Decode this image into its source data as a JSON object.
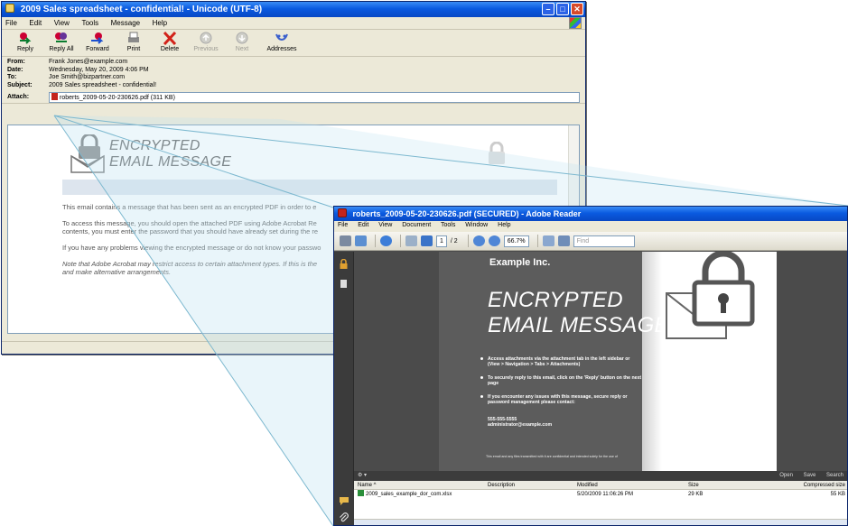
{
  "email": {
    "title": "2009 Sales spreadsheet - confidential! - Unicode (UTF-8)",
    "menu": [
      "File",
      "Edit",
      "View",
      "Tools",
      "Message",
      "Help"
    ],
    "toolbar": {
      "reply": "Reply",
      "reply_all": "Reply All",
      "forward": "Forward",
      "print": "Print",
      "delete": "Delete",
      "previous": "Previous",
      "next": "Next",
      "addresses": "Addresses"
    },
    "headers": {
      "from_label": "From:",
      "from": "Frank Jones@example.com",
      "date_label": "Date:",
      "date": "Wednesday, May 20, 2009 4:06 PM",
      "to_label": "To:",
      "to": "Joe Smith@bizpartner.com",
      "subject_label": "Subject:",
      "subject": "2009 Sales spreadsheet - confidential!",
      "attach_label": "Attach:",
      "attach": "roberts_2009-05-20-230626.pdf (311 KB)"
    },
    "body": {
      "title_line1": "ENCRYPTED",
      "title_line2": "EMAIL MESSAGE",
      "p1": "This email contains a message that has been sent as an encrypted PDF in order to e",
      "p2a": "To access this message, you should open the attached PDF using Adobe Acrobat Re",
      "p2b": "contents, you must enter the password that you should have already set during the re",
      "p3": "If you have any problems viewing the encrypted message or do not know your passwo",
      "p4a": "Note that Adobe Acrobat may restrict access to certain attachment types.  If this is the",
      "p4b": "and make alternative arrangements."
    }
  },
  "reader": {
    "title": "roberts_2009-05-20-230626.pdf (SECURED) - Adobe Reader",
    "menu": [
      "File",
      "Edit",
      "View",
      "Document",
      "Tools",
      "Window",
      "Help"
    ],
    "page_current": "1",
    "page_total": "/ 2",
    "zoom": "66.7%",
    "find_placeholder": "Find",
    "doc": {
      "company": "Example Inc.",
      "title_line1": "ENCRYPTED",
      "title_line2": "EMAIL MESSAGE",
      "bullets": [
        "Access attachments via the attachment tab in the left sidebar or (View > Navigation > Tabs > Attachments)",
        "To securely reply to this email, click on the 'Reply' button on the next page",
        "If you encounter any issues with this message, secure reply or password management please contact:"
      ],
      "phone": "555-555-5555",
      "contact_email": "administrator@example.com",
      "footer": "This email and any files transmitted with it are confidential and intended solely for the use of"
    },
    "attachments": {
      "open_label": "Open",
      "save_label": "Save",
      "search_label": "Search",
      "headers": [
        "Name",
        "Description",
        "Modified",
        "Size",
        "Compressed size"
      ],
      "rows": [
        {
          "name": "2009_sales_example_dor_com.xlsx",
          "description": "",
          "modified": "5/20/2009 11:06:26 PM",
          "size": "29 KB",
          "compressed": "55 KB"
        }
      ]
    }
  },
  "colors": {
    "xp_title": "#0a5ae0",
    "xp_face": "#ece9d8",
    "reader_dark": "#4b4b4b",
    "zoom_tint": "#bfe3f0"
  }
}
